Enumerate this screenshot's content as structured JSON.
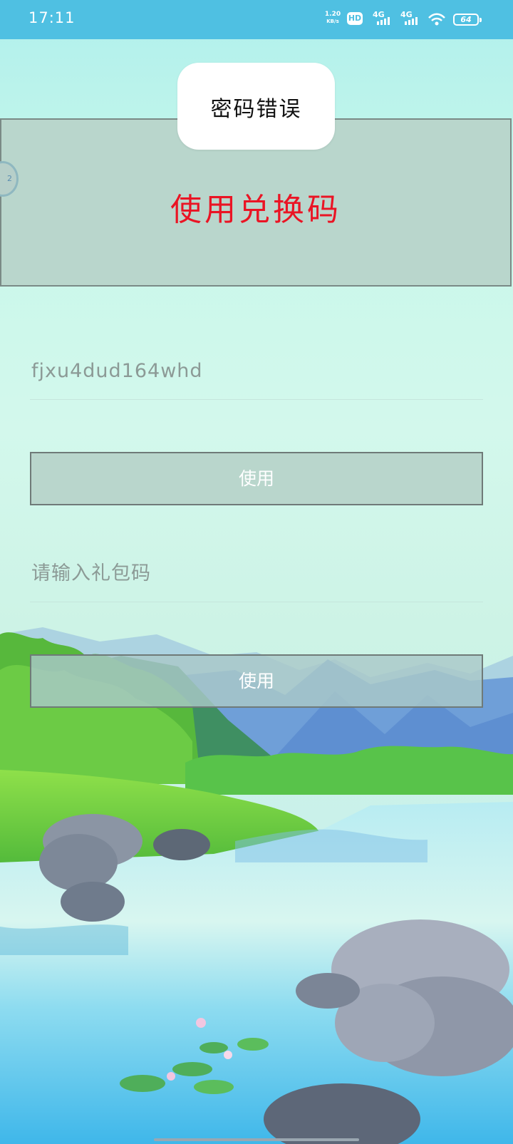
{
  "status_bar": {
    "time": "17:11",
    "net_speed_value": "1.20",
    "net_speed_unit": "KB/s",
    "hd_label": "HD",
    "sim1_label": "4G",
    "sim2_label": "4G",
    "battery": "64"
  },
  "toast": {
    "message": "密码错误"
  },
  "banner": {
    "title": "使用兑换码"
  },
  "side_handle": {
    "label": "2"
  },
  "redeem_form": {
    "code_value": "fjxu4dud164whd",
    "use_button_label": "使用"
  },
  "gift_form": {
    "placeholder": "请输入礼包码",
    "use_button_label": "使用"
  },
  "colors": {
    "status_bar": "#4fc0e2",
    "banner_bg": "#b9d6cc",
    "banner_title": "#ea1424",
    "page_bg": "#c8f7ea"
  }
}
